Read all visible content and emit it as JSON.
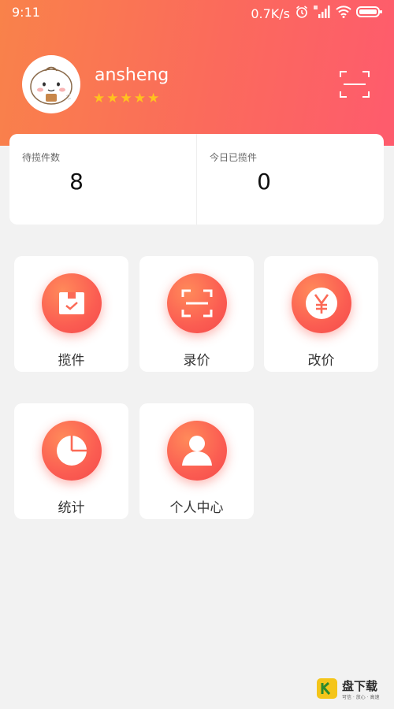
{
  "status_bar": {
    "time": "9:11",
    "speed": "0.7K/s",
    "icons": [
      "alarm-icon",
      "signal-icon",
      "wifi-icon",
      "battery-icon"
    ]
  },
  "profile": {
    "username": "ansheng",
    "rating": 5,
    "avatar": "avatar-bun-cartoon",
    "scan_icon": "scan-icon"
  },
  "stats": {
    "pending_label": "待揽件数",
    "pending_value": "8",
    "today_label": "今日已揽件",
    "today_value": "0"
  },
  "menu": [
    {
      "label": "揽件",
      "icon": "box-check-icon"
    },
    {
      "label": "录价",
      "icon": "scan-frame-icon"
    },
    {
      "label": "改价",
      "icon": "yen-icon"
    },
    {
      "label": "统计",
      "icon": "pie-chart-icon"
    },
    {
      "label": "个人中心",
      "icon": "person-icon"
    }
  ],
  "watermark": {
    "text": "盘下载",
    "sub": "可信 · 放心 · 高速",
    "logo_mark": "K"
  },
  "colors": {
    "header_start": "#f9824a",
    "header_end": "#fe5b6d",
    "icon_red": "#fb5d52",
    "star_gold": "#ffc21f"
  }
}
